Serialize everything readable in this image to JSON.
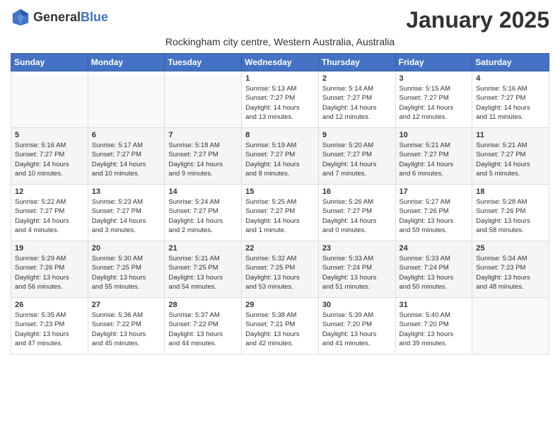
{
  "header": {
    "logo": {
      "general": "General",
      "blue": "Blue"
    },
    "title": "January 2025",
    "subtitle": "Rockingham city centre, Western Australia, Australia"
  },
  "days_of_week": [
    "Sunday",
    "Monday",
    "Tuesday",
    "Wednesday",
    "Thursday",
    "Friday",
    "Saturday"
  ],
  "weeks": [
    [
      {
        "day": "",
        "content": ""
      },
      {
        "day": "",
        "content": ""
      },
      {
        "day": "",
        "content": ""
      },
      {
        "day": "1",
        "content": "Sunrise: 5:13 AM\nSunset: 7:27 PM\nDaylight: 14 hours\nand 13 minutes."
      },
      {
        "day": "2",
        "content": "Sunrise: 5:14 AM\nSunset: 7:27 PM\nDaylight: 14 hours\nand 12 minutes."
      },
      {
        "day": "3",
        "content": "Sunrise: 5:15 AM\nSunset: 7:27 PM\nDaylight: 14 hours\nand 12 minutes."
      },
      {
        "day": "4",
        "content": "Sunrise: 5:16 AM\nSunset: 7:27 PM\nDaylight: 14 hours\nand 11 minutes."
      }
    ],
    [
      {
        "day": "5",
        "content": "Sunrise: 5:16 AM\nSunset: 7:27 PM\nDaylight: 14 hours\nand 10 minutes."
      },
      {
        "day": "6",
        "content": "Sunrise: 5:17 AM\nSunset: 7:27 PM\nDaylight: 14 hours\nand 10 minutes."
      },
      {
        "day": "7",
        "content": "Sunrise: 5:18 AM\nSunset: 7:27 PM\nDaylight: 14 hours\nand 9 minutes."
      },
      {
        "day": "8",
        "content": "Sunrise: 5:19 AM\nSunset: 7:27 PM\nDaylight: 14 hours\nand 8 minutes."
      },
      {
        "day": "9",
        "content": "Sunrise: 5:20 AM\nSunset: 7:27 PM\nDaylight: 14 hours\nand 7 minutes."
      },
      {
        "day": "10",
        "content": "Sunrise: 5:21 AM\nSunset: 7:27 PM\nDaylight: 14 hours\nand 6 minutes."
      },
      {
        "day": "11",
        "content": "Sunrise: 5:21 AM\nSunset: 7:27 PM\nDaylight: 14 hours\nand 5 minutes."
      }
    ],
    [
      {
        "day": "12",
        "content": "Sunrise: 5:22 AM\nSunset: 7:27 PM\nDaylight: 14 hours\nand 4 minutes."
      },
      {
        "day": "13",
        "content": "Sunrise: 5:23 AM\nSunset: 7:27 PM\nDaylight: 14 hours\nand 3 minutes."
      },
      {
        "day": "14",
        "content": "Sunrise: 5:24 AM\nSunset: 7:27 PM\nDaylight: 14 hours\nand 2 minutes."
      },
      {
        "day": "15",
        "content": "Sunrise: 5:25 AM\nSunset: 7:27 PM\nDaylight: 14 hours\nand 1 minute."
      },
      {
        "day": "16",
        "content": "Sunrise: 5:26 AM\nSunset: 7:27 PM\nDaylight: 14 hours\nand 0 minutes."
      },
      {
        "day": "17",
        "content": "Sunrise: 5:27 AM\nSunset: 7:26 PM\nDaylight: 13 hours\nand 59 minutes."
      },
      {
        "day": "18",
        "content": "Sunrise: 5:28 AM\nSunset: 7:26 PM\nDaylight: 13 hours\nand 58 minutes."
      }
    ],
    [
      {
        "day": "19",
        "content": "Sunrise: 5:29 AM\nSunset: 7:26 PM\nDaylight: 13 hours\nand 56 minutes."
      },
      {
        "day": "20",
        "content": "Sunrise: 5:30 AM\nSunset: 7:25 PM\nDaylight: 13 hours\nand 55 minutes."
      },
      {
        "day": "21",
        "content": "Sunrise: 5:31 AM\nSunset: 7:25 PM\nDaylight: 13 hours\nand 54 minutes."
      },
      {
        "day": "22",
        "content": "Sunrise: 5:32 AM\nSunset: 7:25 PM\nDaylight: 13 hours\nand 53 minutes."
      },
      {
        "day": "23",
        "content": "Sunrise: 5:33 AM\nSunset: 7:24 PM\nDaylight: 13 hours\nand 51 minutes."
      },
      {
        "day": "24",
        "content": "Sunrise: 5:33 AM\nSunset: 7:24 PM\nDaylight: 13 hours\nand 50 minutes."
      },
      {
        "day": "25",
        "content": "Sunrise: 5:34 AM\nSunset: 7:23 PM\nDaylight: 13 hours\nand 48 minutes."
      }
    ],
    [
      {
        "day": "26",
        "content": "Sunrise: 5:35 AM\nSunset: 7:23 PM\nDaylight: 13 hours\nand 47 minutes."
      },
      {
        "day": "27",
        "content": "Sunrise: 5:36 AM\nSunset: 7:22 PM\nDaylight: 13 hours\nand 45 minutes."
      },
      {
        "day": "28",
        "content": "Sunrise: 5:37 AM\nSunset: 7:22 PM\nDaylight: 13 hours\nand 44 minutes."
      },
      {
        "day": "29",
        "content": "Sunrise: 5:38 AM\nSunset: 7:21 PM\nDaylight: 13 hours\nand 42 minutes."
      },
      {
        "day": "30",
        "content": "Sunrise: 5:39 AM\nSunset: 7:20 PM\nDaylight: 13 hours\nand 41 minutes."
      },
      {
        "day": "31",
        "content": "Sunrise: 5:40 AM\nSunset: 7:20 PM\nDaylight: 13 hours\nand 39 minutes."
      },
      {
        "day": "",
        "content": ""
      }
    ]
  ]
}
